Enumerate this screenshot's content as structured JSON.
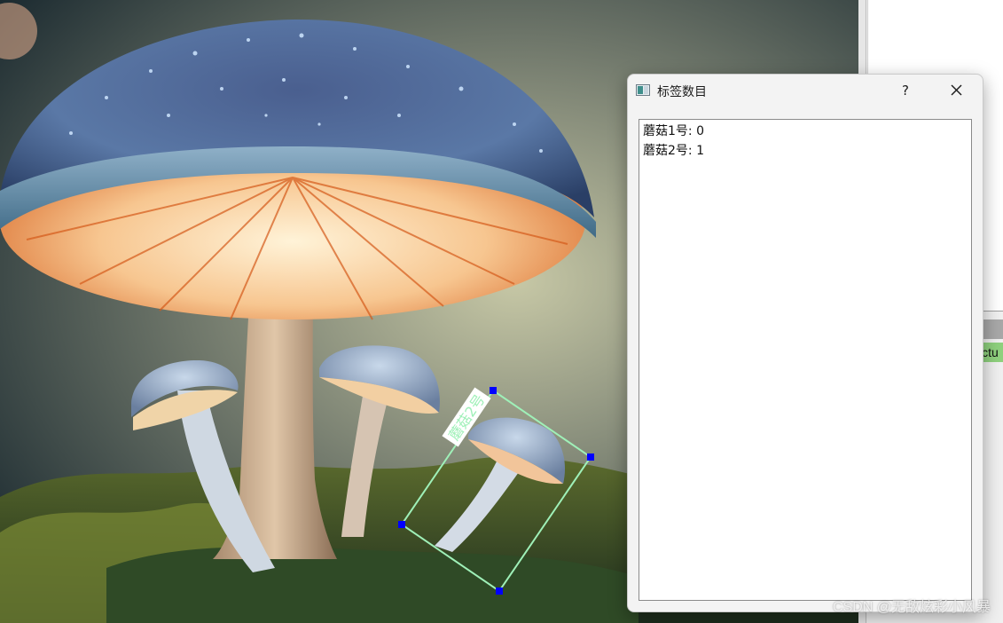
{
  "dialog": {
    "title": "标签数目",
    "help_label": "?",
    "items": [
      {
        "label": "蘑菇1号: 0"
      },
      {
        "label": "蘑菇2号: 1"
      }
    ]
  },
  "annotation": {
    "label": "蘑菇2号",
    "box_color": "#9ff0b8",
    "handle_color": "#0000ff"
  },
  "right_panel": {
    "green_text": "ictu"
  },
  "watermark": "CSDN @无敌炫彩小风暴"
}
